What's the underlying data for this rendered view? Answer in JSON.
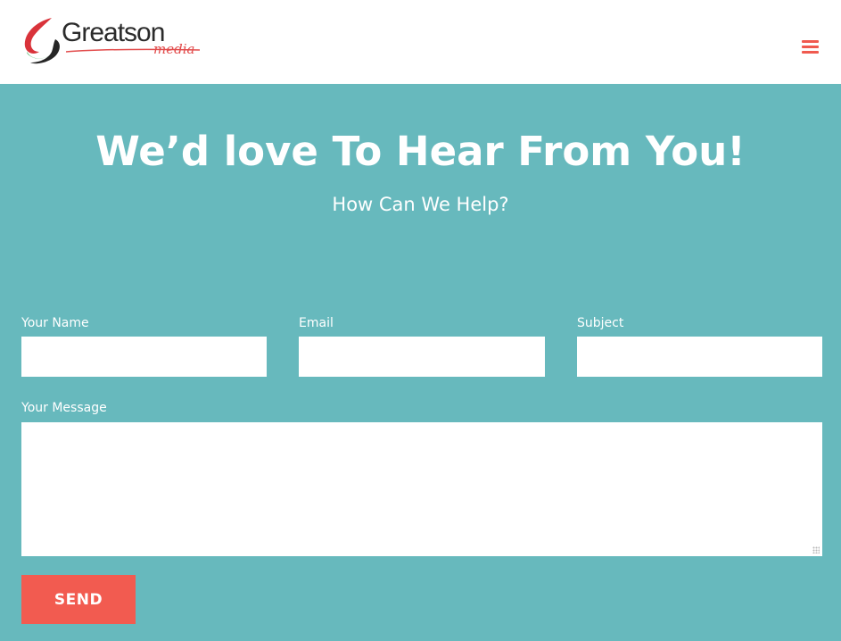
{
  "header": {
    "logo_word": "Greatson",
    "logo_sub": "media",
    "menu_icon": "hamburger-menu-icon"
  },
  "hero": {
    "title": "We’d love To Hear From You!",
    "subtitle": "How Can We Help?"
  },
  "form": {
    "name_label": "Your Name",
    "name_value": "",
    "email_label": "Email",
    "email_value": "",
    "subject_label": "Subject",
    "subject_value": "",
    "message_label": "Your Message",
    "message_value": "",
    "send_label": "SEND"
  },
  "colors": {
    "background": "#67b9bd",
    "accent": "#f25b50",
    "header": "#ffffff"
  }
}
